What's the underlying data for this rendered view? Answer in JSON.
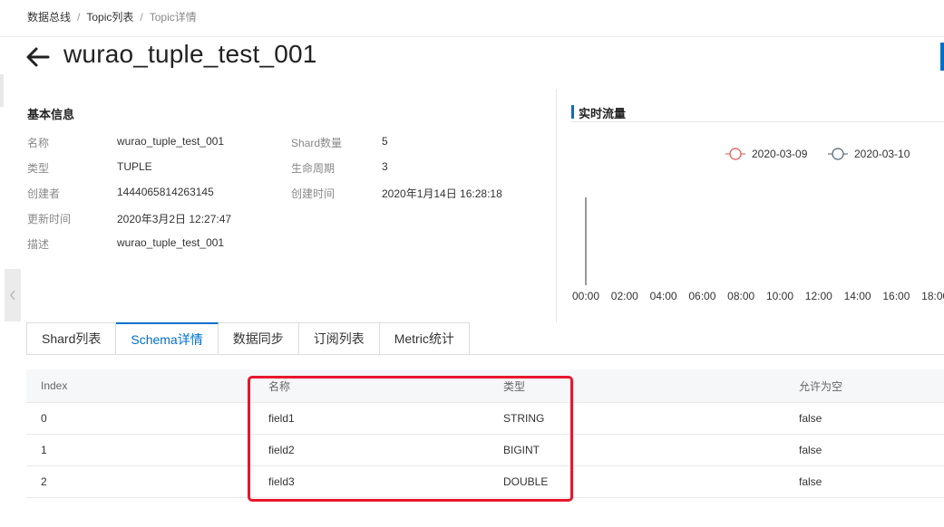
{
  "breadcrumb": [
    "数据总线",
    "Topic列表",
    "Topic详情"
  ],
  "header": {
    "title": "wurao_tuple_test_001"
  },
  "basic_info": {
    "title": "基本信息",
    "fields": [
      {
        "label": "名称",
        "value": "wurao_tuple_test_001"
      },
      {
        "label": "类型",
        "value": "TUPLE"
      },
      {
        "label": "创建者",
        "value": "1444065814263145"
      },
      {
        "label": "更新时间",
        "value": "2020年3月2日 12:27:47"
      },
      {
        "label": "描述",
        "value": "wurao_tuple_test_001"
      },
      {
        "label": "Shard数量",
        "value": "5"
      },
      {
        "label": "生命周期",
        "value": "3"
      },
      {
        "label": "创建时间",
        "value": "2020年1月14日 16:28:18"
      }
    ]
  },
  "chart_panel": {
    "title": "实时流量"
  },
  "chart_data": {
    "type": "line",
    "x_ticks": [
      "00:00",
      "02:00",
      "04:00",
      "06:00",
      "08:00",
      "10:00",
      "12:00",
      "14:00",
      "16:00",
      "18:00"
    ],
    "series": [
      {
        "name": "2020-03-09",
        "color": "#d9534f",
        "values": []
      },
      {
        "name": "2020-03-10",
        "color": "#4d5f6e",
        "values": []
      }
    ],
    "legend": "top-right",
    "grid": false
  },
  "tabs": [
    {
      "label": "Shard列表",
      "active": false
    },
    {
      "label": "Schema详情",
      "active": true
    },
    {
      "label": "数据同步",
      "active": false
    },
    {
      "label": "订阅列表",
      "active": false
    },
    {
      "label": "Metric统计",
      "active": false
    }
  ],
  "schema_table": {
    "columns": [
      "Index",
      "名称",
      "类型",
      "允许为空"
    ],
    "rows": [
      [
        "0",
        "field1",
        "STRING",
        "false"
      ],
      [
        "1",
        "field2",
        "BIGINT",
        "false"
      ],
      [
        "2",
        "field3",
        "DOUBLE",
        "false"
      ]
    ]
  },
  "colors": {
    "accent": "#0070cc",
    "highlight": "#e8162d"
  },
  "icons": {
    "back": "arrow-left-icon",
    "collapse": "chevron-left-icon"
  }
}
